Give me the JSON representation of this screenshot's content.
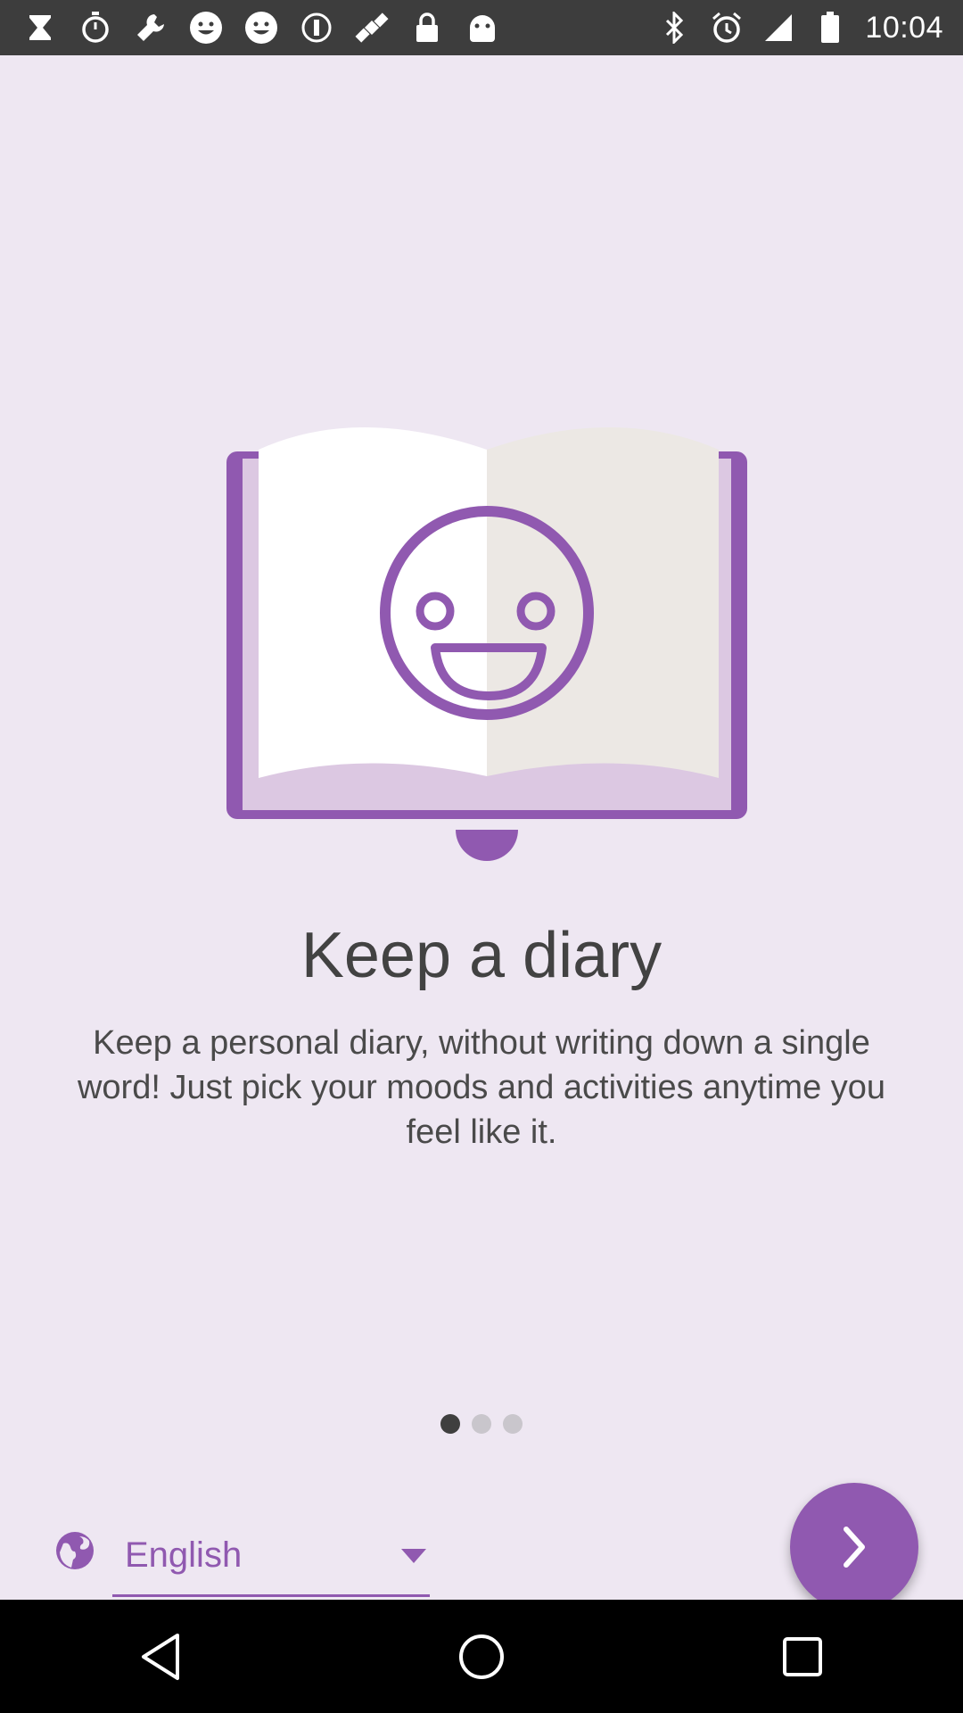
{
  "status_bar": {
    "time": "10:04",
    "left_icons": [
      "hourglass-icon",
      "stopwatch-icon",
      "wrench-icon",
      "smiley-icon",
      "smiley-icon",
      "info-icon",
      "satellite-fake-gps-icon",
      "lock-icon",
      "android-icon"
    ],
    "right_icons": [
      "bluetooth-icon",
      "alarm-icon",
      "signal-icon",
      "battery-icon"
    ]
  },
  "onboarding": {
    "title": "Keep a diary",
    "description": "Keep a personal diary, without writing down a single word! Just pick your moods and activities anytime you feel like it.",
    "page_indicator": {
      "total": 3,
      "active_index": 0
    }
  },
  "language": {
    "selected": "English",
    "icon": "globe-icon"
  },
  "next_button": {
    "icon": "chevron-right-icon"
  },
  "colors": {
    "accent": "#9059B0",
    "background": "#EEE7F2",
    "text": "#424242"
  },
  "nav_bar": [
    "back-icon",
    "home-icon",
    "recents-icon"
  ]
}
